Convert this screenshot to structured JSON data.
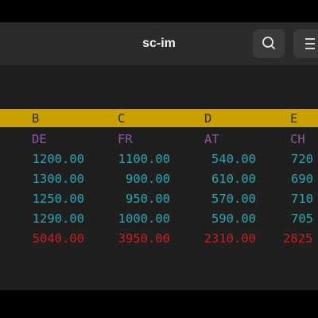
{
  "window": {
    "title": "sc-im"
  },
  "header_buttons": [
    {
      "icon": "search-icon"
    },
    {
      "icon": "hamburger-menu-icon"
    }
  ],
  "colors": {
    "column_header_bg": "#c9a000",
    "label_text": "#8a5a9a",
    "value_text": "#2aa6b0",
    "total_text": "#cc1f1f",
    "terminal_bg": "#1f1f1f"
  },
  "sheet": {
    "column_letters": [
      "B",
      "C",
      "D",
      "E"
    ],
    "country_labels": [
      "DE",
      "FR",
      "AT",
      "CH"
    ],
    "rows": [
      [
        "1200.00",
        "1100.00",
        "540.00",
        "720"
      ],
      [
        "1300.00",
        "900.00",
        "610.00",
        "690"
      ],
      [
        "1250.00",
        "950.00",
        "570.00",
        "710"
      ],
      [
        "1290.00",
        "1000.00",
        "590.00",
        "705"
      ]
    ],
    "totals": [
      "5040.00",
      "3950.00",
      "2310.00",
      "2825"
    ]
  }
}
